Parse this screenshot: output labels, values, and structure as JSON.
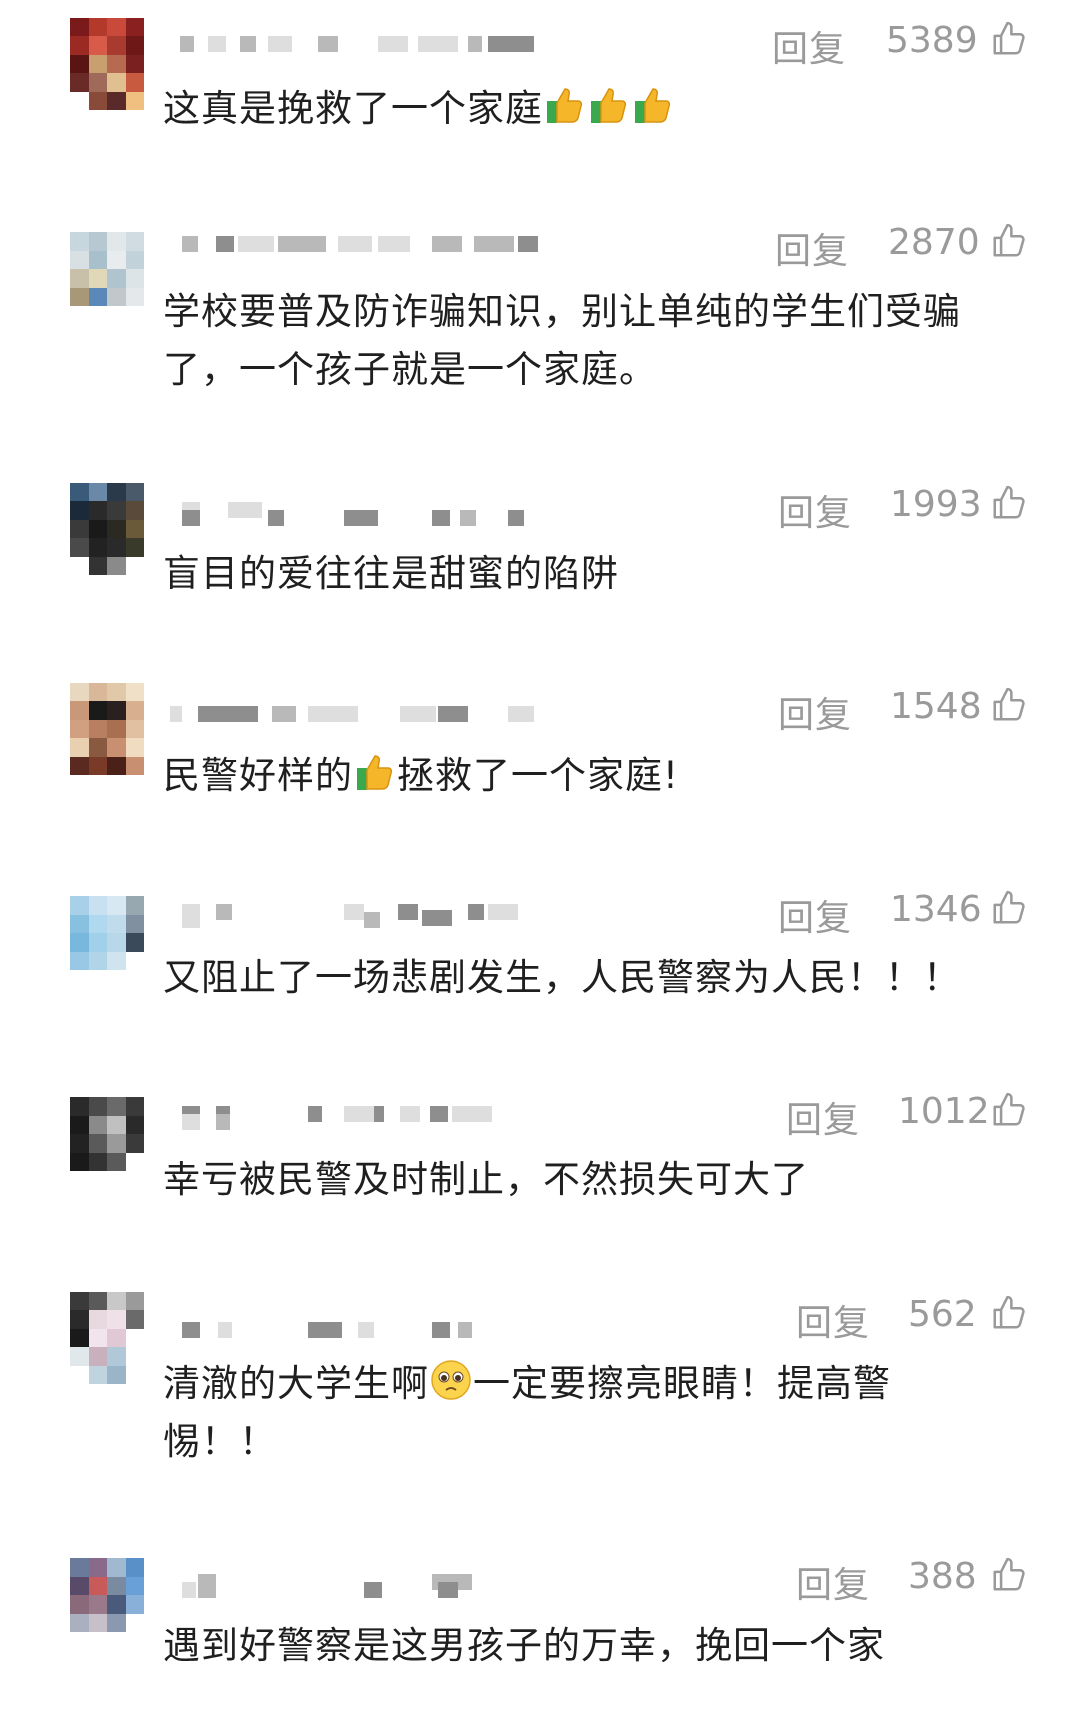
{
  "reply_label": "回复",
  "comments": [
    {
      "likes": "5389",
      "text_a": "这真是挽救了一个家庭",
      "emoji_a": "thumbs-up-icon",
      "emoji_count": 3
    },
    {
      "likes": "2870",
      "text_a": "学校要普及防诈骗知识，别让单纯的学生们受骗了，一个孩子就是一个家庭。"
    },
    {
      "likes": "1993",
      "text_a": "盲目的爱往往是甜蜜的陷阱"
    },
    {
      "likes": "1548",
      "text_a": "民警好样的",
      "emoji_a": "thumbs-up-icon",
      "text_b": "拯救了一个家庭!"
    },
    {
      "likes": "1346",
      "text_a": "又阻止了一场悲剧发生，人民警察为人民！！！"
    },
    {
      "likes": "1012",
      "text_a": "幸亏被民警及时制止，不然损失可大了"
    },
    {
      "likes": "562",
      "text_a": "清澈的大学生啊",
      "emoji_a": "pleading-face-icon",
      "text_b": "一定要擦亮眼睛！提高警惕！！"
    },
    {
      "likes": "388",
      "text_a": "遇到好警察是这男孩子的万幸，挽回一个家"
    }
  ],
  "colors": {
    "text": "#1f1f1f",
    "meta": "#9a9a9a",
    "background": "#ffffff"
  }
}
